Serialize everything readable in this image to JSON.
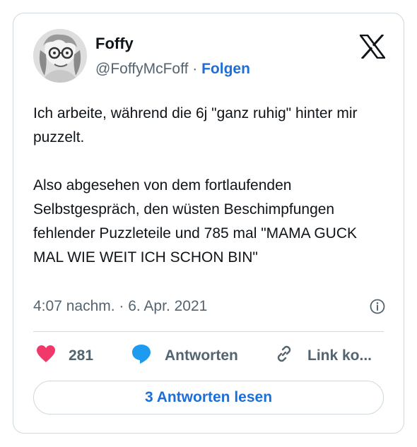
{
  "author": {
    "display_name": "Foffy",
    "handle": "@FoffyMcFoff",
    "separator": "·",
    "follow_label": "Folgen"
  },
  "tweet": {
    "paragraphs": [
      "Ich arbeite, während die 6j \"ganz ruhig\" hinter mir puzzelt.",
      "Also abgesehen von dem fortlaufenden Selbstgespräch, den wüsten Beschimpfungen fehlender Puzzleteile und 785 mal \"MAMA GUCK MAL WIE WEIT ICH SCHON BIN\""
    ],
    "timestamp": "4:07 nachm. · 6. Apr. 2021"
  },
  "actions": {
    "like_count": "281",
    "reply_label": "Antworten",
    "copy_link_label": "Link ko..."
  },
  "read_replies_label": "3 Antworten lesen",
  "icons": {
    "logo": "x-logo-icon",
    "info": "info-icon",
    "like": "heart-icon",
    "reply": "speech-bubble-icon",
    "link": "chain-link-icon"
  },
  "colors": {
    "heart": "#f0386b",
    "reply_bubble": "#1d9bf0",
    "link_blue": "#1d6fd8",
    "secondary_text": "#536471",
    "border": "#cfd9de"
  }
}
